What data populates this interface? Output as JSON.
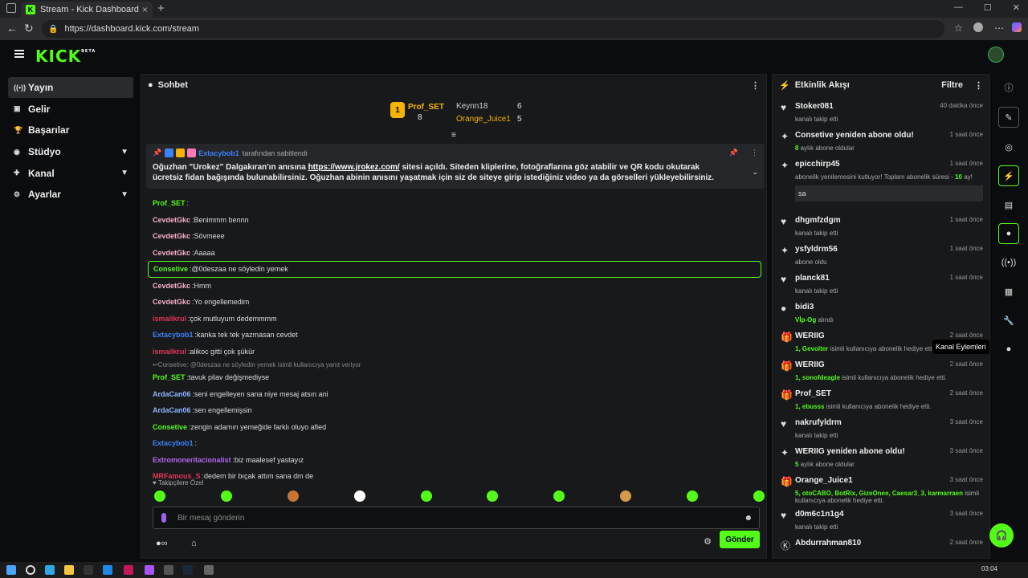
{
  "browser": {
    "tab_title": "Stream - Kick Dashboard",
    "url": "https://dashboard.kick.com/stream"
  },
  "app": {
    "logo": "KICK",
    "logo_beta": "BETA"
  },
  "sidebar": {
    "items": [
      {
        "label": "Yayın",
        "icon": "broadcast-icon"
      },
      {
        "label": "Gelir",
        "icon": "revenue-icon"
      },
      {
        "label": "Başarılar",
        "icon": "trophy-icon"
      },
      {
        "label": "Stüdyo",
        "icon": "studio-icon",
        "expandable": true
      },
      {
        "label": "Kanal",
        "icon": "channel-icon",
        "expandable": true
      },
      {
        "label": "Ayarlar",
        "icon": "gear-icon",
        "expandable": true
      }
    ]
  },
  "chat": {
    "title": "Sohbet",
    "leaderboard": [
      {
        "name": "Prof_SET",
        "count": "8"
      },
      {
        "name": "Keynn18",
        "count": "6"
      },
      {
        "name": "Orange_Juice1",
        "count": "5"
      }
    ],
    "pinned": {
      "pinned_by_user": "Extacybob1",
      "pinned_by_text": "tarafından sabitlendi",
      "message_a": "Oğuzhan \"Urokez\" Dalgakıran'ın anısına ",
      "link": "https://www.jrokez.com/",
      "message_b": " sitesi açıldı. Siteden kliplerine, fotoğraflarına göz atabilir ve QR kodu okutarak ücretsiz fidan bağışında bulunabilirsiniz. Oğuzhan abinin anısını yaşatmak için siz de siteye girip istediğiniz video ya da görselleri yükleyebilirsiniz."
    },
    "messages": [
      {
        "user": "Prof_SET",
        "text": "",
        "color": "#53fc18"
      },
      {
        "user": "CevdetGkc",
        "text": "Benimmm bennn",
        "color": "#f7b0c8"
      },
      {
        "user": "CevdetGkc",
        "text": "Sövmeee",
        "color": "#f7b0c8"
      },
      {
        "user": "CevdetGkc",
        "text": "Aaaaa",
        "color": "#f7b0c8"
      },
      {
        "user": "Consetive",
        "text": "@0deszaa ne söyledin yemek",
        "color": "#53fc18",
        "highlight": true
      },
      {
        "user": "CevdetGkc",
        "text": "Hmm",
        "color": "#f7b0c8"
      },
      {
        "user": "CevdetGkc",
        "text": "Yo engellemedim",
        "color": "#f7b0c8"
      },
      {
        "user": "ismailkrul",
        "text": "çok mutluyum dedemmmm",
        "color": "#e0345a"
      },
      {
        "user": "Extacybob1",
        "text": "kanka tek tek yazmasan cevdet",
        "color": "#3b82f6"
      },
      {
        "user": "ismailkrul",
        "text": "alikoc gitti çok şükür",
        "color": "#e0345a"
      },
      {
        "reply": true,
        "text": "Consetive: @0deszaa ne söyledin yemek isimli kullanıcıya yanıt veriyor"
      },
      {
        "user": "Prof_SET",
        "text": "tavuk pilav değişmediyse",
        "color": "#53fc18"
      },
      {
        "user": "ArdaCan06",
        "text": "seni engelleyen sana niye mesaj atsın ani",
        "color": "#8ab4f8"
      },
      {
        "user": "ArdaCan06",
        "text": "sen engellemişsin",
        "color": "#8ab4f8"
      },
      {
        "user": "Consetive",
        "text": "zengin adamın yemeğide farklı oluyo afied",
        "color": "#53fc18"
      },
      {
        "user": "Extacybob1",
        "text": "",
        "color": "#3b82f6"
      },
      {
        "user": "Extromoneritacionalist",
        "text": "biz maalesef yastayız",
        "color": "#b366f0"
      },
      {
        "user": "MRFamous_S",
        "text": "dedem bir bıçak attım sana dm de",
        "color": "#e0345a"
      }
    ],
    "followers_only": "Takipçilere Özel",
    "input_placeholder": "Bir mesaj gönderin",
    "send_label": "Gönder"
  },
  "feed": {
    "title": "Etkinlik Akışı",
    "filter_label": "Filtre",
    "events": [
      {
        "icon": "heart-icon",
        "name": "Stoker081",
        "time": "40 dakika önce",
        "sub": "kanalı takip etti"
      },
      {
        "icon": "star-icon",
        "name": "Consetive yeniden abone oldu!",
        "time": "1 saat önce",
        "sub_g": "8",
        "sub": " aylık abone oldular"
      },
      {
        "icon": "star-icon",
        "name": "epicchirp45",
        "time": "1 saat önce",
        "sub": "abonelik yenilemesini kutluyor! Toplam abonelik süresi - ",
        "sub_g2": "10",
        "sub_tail": " ay!",
        "quote": "sa"
      },
      {
        "icon": "heart-icon",
        "name": "dhgmfzdgm",
        "time": "1 saat önce",
        "sub": "kanalı takip etti"
      },
      {
        "icon": "star-icon",
        "name": "ysfyldrm56",
        "time": "1 saat önce",
        "sub": "abone oldu"
      },
      {
        "icon": "heart-icon",
        "name": "planck81",
        "time": "1 saat önce",
        "sub": "kanalı takip etti"
      },
      {
        "icon": "kick-icon",
        "name": "bidi3",
        "time": "",
        "sub_g": "Vİp-Og",
        "sub": " alındı"
      },
      {
        "icon": "gift-icon",
        "name": "WERIIG",
        "time": "2 saat önce",
        "sub_g": "1, Gevolter",
        "sub": " isimli kullanıcıya abonelik hediye etti."
      },
      {
        "icon": "gift-icon",
        "name": "WERIIG",
        "time": "2 saat önce",
        "sub_g": "1, sonofdeagle",
        "sub": " isimli kullanıcıya abonelik hediye etti."
      },
      {
        "icon": "gift-icon",
        "name": "Prof_SET",
        "time": "2 saat önce",
        "sub_g": "1, ebusss",
        "sub": " isimli kullanıcıya abonelik hediye etti."
      },
      {
        "icon": "heart-icon",
        "name": "nakrufyldrm",
        "time": "3 saat önce",
        "sub": "kanalı takip etti"
      },
      {
        "icon": "star-icon",
        "name": "WERIIG yeniden abone oldu!",
        "time": "3 saat önce",
        "sub_g": "5",
        "sub": " aylık abone oldular"
      },
      {
        "icon": "gift-icon",
        "name": "Orange_Juice1",
        "time": "3 saat önce",
        "sub_g": "5, otoCABO, BotRix, GizeOnee, Caesar3_3, karmarraen",
        "sub": " isimli kullanıcıya abonelik hediye etti."
      },
      {
        "icon": "heart-icon",
        "name": "d0m6c1n1g4",
        "time": "3 saat önce",
        "sub": "kanalı takip etti"
      },
      {
        "icon": "k-icon",
        "name": "Abdurrahman810",
        "time": "2 saat önce",
        "sub": ""
      }
    ]
  },
  "tooltip": "Kanal Eylemleri",
  "clock": "03:04"
}
